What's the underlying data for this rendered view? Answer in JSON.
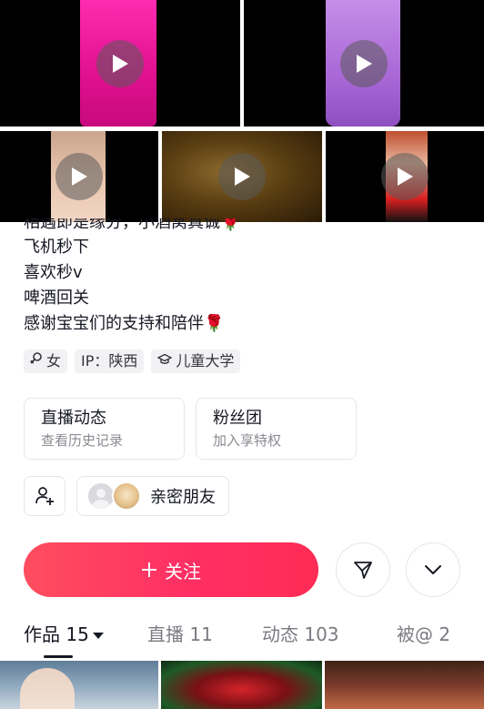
{
  "videos": [
    {
      "id": "video-1"
    },
    {
      "id": "video-2"
    },
    {
      "id": "video-3"
    },
    {
      "id": "video-4"
    },
    {
      "id": "video-5"
    }
  ],
  "bio": {
    "lines": [
      "相遇即是缘分，小酒窝真诚",
      "飞机秒下",
      "喜欢秒v",
      "啤酒回关",
      "感谢宝宝们的支持和陪伴"
    ],
    "rose": "🌹"
  },
  "tags": {
    "gender": "女",
    "ip": "IP：陕西",
    "school": "儿童大学"
  },
  "cards": {
    "live": {
      "title": "直播动态",
      "subtitle": "查看历史记录"
    },
    "fans": {
      "title": "粉丝团",
      "subtitle": "加入享特权"
    }
  },
  "friends": {
    "close_friends_label": "亲密朋友"
  },
  "actions": {
    "follow_label": "关注"
  },
  "tabs": [
    {
      "label": "作品 15"
    },
    {
      "label": "直播 11"
    },
    {
      "label": "动态 103"
    },
    {
      "label": "被@ 2"
    }
  ],
  "colors": {
    "accent": "#fe2c55",
    "text": "#161823",
    "muted": "#8a8b91"
  }
}
